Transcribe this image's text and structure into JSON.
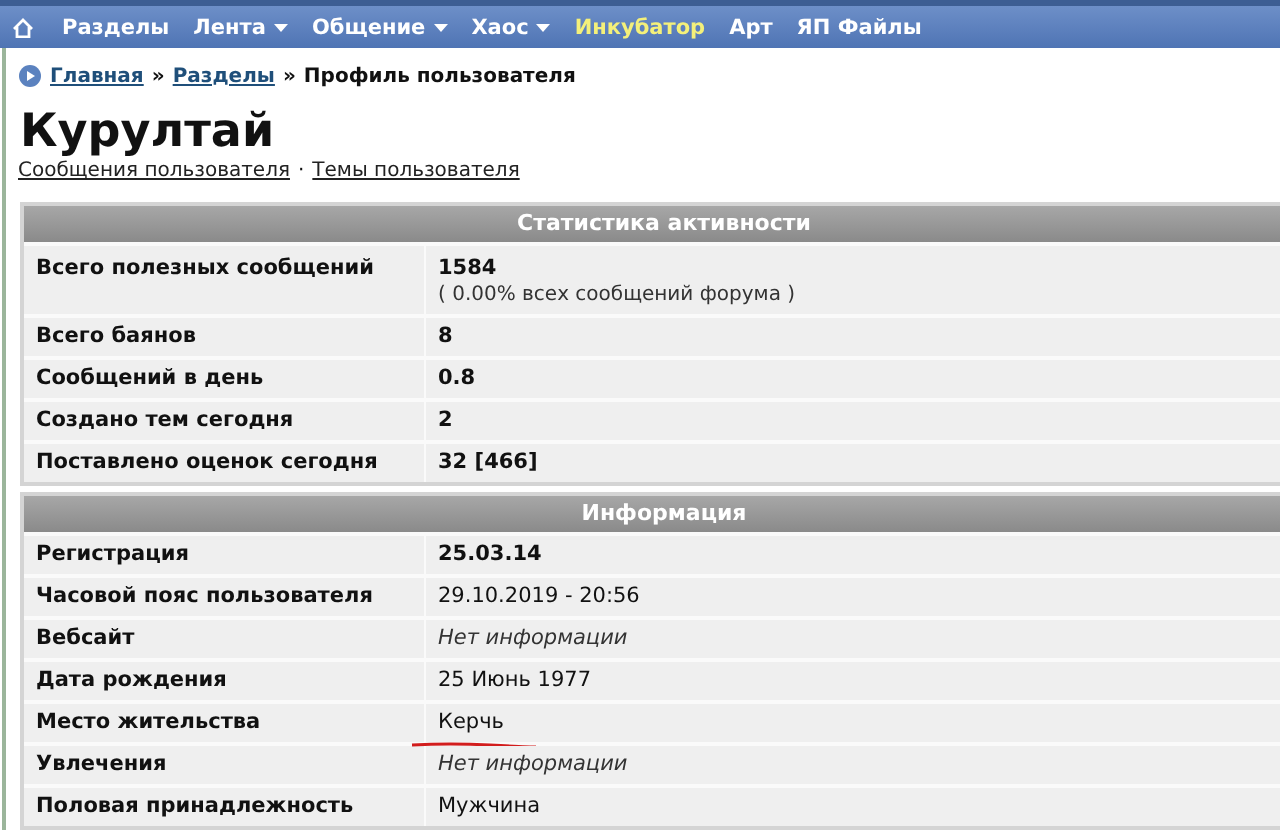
{
  "nav": {
    "items": [
      {
        "label": "Разделы",
        "dropdown": false,
        "highlighted": false
      },
      {
        "label": "Лента",
        "dropdown": true,
        "highlighted": false
      },
      {
        "label": "Общение",
        "dropdown": true,
        "highlighted": false
      },
      {
        "label": "Хаос",
        "dropdown": true,
        "highlighted": false
      },
      {
        "label": "Инкубатор",
        "dropdown": false,
        "highlighted": true
      },
      {
        "label": "Арт",
        "dropdown": false,
        "highlighted": false
      },
      {
        "label": "ЯП Файлы",
        "dropdown": false,
        "highlighted": false
      }
    ]
  },
  "breadcrumb": {
    "links": [
      "Главная",
      "Разделы"
    ],
    "current": "Профиль пользователя",
    "separator": "»"
  },
  "profile": {
    "name": "Курултай",
    "links": [
      "Сообщения пользователя",
      "Темы пользователя"
    ],
    "link_separator": "·"
  },
  "sections": [
    {
      "title": "Статистика активности",
      "rows": [
        {
          "label": "Всего полезных сообщений",
          "value": "1584",
          "note": "( 0.00% всех сообщений форума )",
          "kind": "bold",
          "marked": false
        },
        {
          "label": "Всего баянов",
          "value": "8",
          "kind": "bold",
          "marked": false
        },
        {
          "label": "Сообщений в день",
          "value": "0.8",
          "kind": "bold",
          "marked": false
        },
        {
          "label": "Создано тем сегодня",
          "value": "2",
          "kind": "bold",
          "marked": false
        },
        {
          "label": "Поставлено оценок сегодня",
          "value": "32 [466]",
          "kind": "bold",
          "marked": false
        }
      ]
    },
    {
      "title": "Информация",
      "rows": [
        {
          "label": "Регистрация",
          "value": "25.03.14",
          "kind": "bold",
          "marked": false
        },
        {
          "label": "Часовой пояс пользователя",
          "value": "29.10.2019 - 20:56",
          "kind": "plain",
          "marked": false
        },
        {
          "label": "Вебсайт",
          "value": "Нет информации",
          "kind": "empty",
          "marked": false
        },
        {
          "label": "Дата рождения",
          "value": "25 Июнь 1977",
          "kind": "plain",
          "marked": false
        },
        {
          "label": "Место жительства",
          "value": "Керчь",
          "kind": "plain",
          "marked": true
        },
        {
          "label": "Увлечения",
          "value": "Нет информации",
          "kind": "empty",
          "marked": false
        },
        {
          "label": "Половая принадлежность",
          "value": "Мужчина",
          "kind": "plain",
          "marked": false
        }
      ]
    }
  ]
}
